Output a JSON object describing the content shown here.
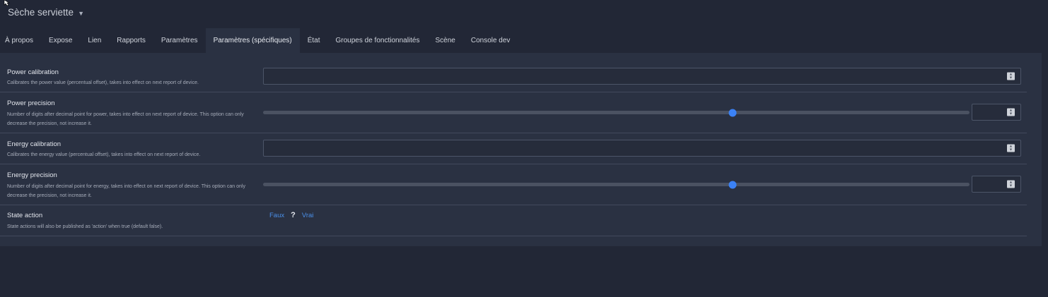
{
  "device": {
    "name": "Sèche serviette"
  },
  "tabs": [
    {
      "label": "À propos"
    },
    {
      "label": "Expose"
    },
    {
      "label": "Lien"
    },
    {
      "label": "Rapports"
    },
    {
      "label": "Paramètres"
    },
    {
      "label": "Paramètres (spécifiques)",
      "active": true
    },
    {
      "label": "État"
    },
    {
      "label": "Groupes de fonctionnalités"
    },
    {
      "label": "Scène"
    },
    {
      "label": "Console dev"
    }
  ],
  "settings": {
    "power_calibration": {
      "label": "Power calibration",
      "description": "Calibrates the power value (percentual offset), takes into effect on next report of device.",
      "value": ""
    },
    "power_precision": {
      "label": "Power precision",
      "description": "Number of digits after decimal point for power, takes into effect on next report of device. This option can only decrease the precision, not increase it.",
      "slider_fraction": 0.665,
      "value": ""
    },
    "energy_calibration": {
      "label": "Energy calibration",
      "description": "Calibrates the energy value (percentual offset), takes into effect on next report of device.",
      "value": ""
    },
    "energy_precision": {
      "label": "Energy precision",
      "description": "Number of digits after decimal point for energy, takes into effect on next report of device. This option can only decrease the precision, not increase it.",
      "slider_fraction": 0.665,
      "value": ""
    },
    "state_action": {
      "label": "State action",
      "description": "State actions will also be published as 'action' when true (default false).",
      "option_false": "Faux",
      "option_unknown": "?",
      "option_true": "Vrai"
    }
  },
  "colors": {
    "accent": "#3b82f6",
    "background": "#222736",
    "panel": "#2a3142"
  }
}
